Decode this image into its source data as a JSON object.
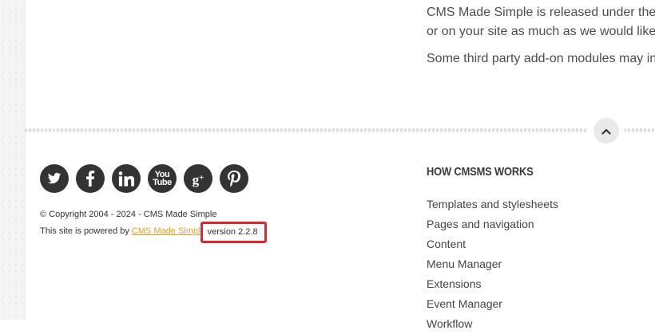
{
  "intro": {
    "line1": "CMS Made Simple is released under the",
    "line2": "or on your site as much as we would like",
    "line3": "Some third party add-on modules may in"
  },
  "scroll_top": {
    "icon": "chevron-up-icon"
  },
  "social_links": [
    {
      "name": "twitter-icon"
    },
    {
      "name": "facebook-icon"
    },
    {
      "name": "linkedin-icon"
    },
    {
      "name": "youtube-icon",
      "glyph_top": "You",
      "glyph_bottom": "Tube"
    },
    {
      "name": "google-plus-icon",
      "glyph": "g",
      "glyph_sup": "+"
    },
    {
      "name": "pinterest-icon"
    }
  ],
  "footer": {
    "copyright": "© Copyright 2004 - 2024 - CMS Made Simple",
    "powered_by": "This site is powered by",
    "powered_link": "CMS Made Simple",
    "version": "version 2.2.8"
  },
  "footer_nav": {
    "heading": "HOW CMSMS WORKS",
    "items": [
      "Templates and stylesheets",
      "Pages and navigation",
      "Content",
      "Menu Manager",
      "Extensions",
      "Event Manager",
      "Workflow"
    ]
  },
  "colors": {
    "social_bg": "#333333",
    "link_orange": "#e0a02a",
    "highlight_red": "#e0242b"
  }
}
